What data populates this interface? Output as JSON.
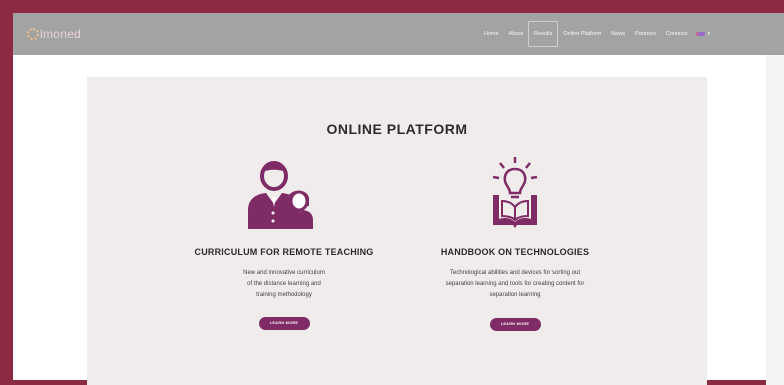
{
  "brand": {
    "logo_text": "lmoned",
    "accent_color": "#7e2b66",
    "frame_color": "#8b2a43"
  },
  "nav": {
    "items": [
      {
        "label": "Home"
      },
      {
        "label": "About"
      },
      {
        "label": "Results",
        "active": true
      },
      {
        "label": "Online Platform"
      },
      {
        "label": "News"
      },
      {
        "label": "Partners"
      },
      {
        "label": "Contacts"
      }
    ],
    "language_icon": "flag-icon"
  },
  "main": {
    "section_title": "ONLINE PLATFORM",
    "cards": [
      {
        "icon": "teacher-student-icon",
        "heading": "CURRICULUM FOR REMOTE TEACHING",
        "text_lines": [
          "New and innovative curriculum",
          "of the distance learning and",
          "training methodology"
        ],
        "button_label": "LEARN MORE"
      },
      {
        "icon": "book-lightbulb-icon",
        "heading": "HANDBOOK ON TECHNOLOGIES",
        "text_lines": [
          "Technological abilities and devices for sorting out",
          "separation learning and tools for creating content for",
          "separation learning"
        ],
        "button_label": "LEARN MORE"
      }
    ]
  }
}
